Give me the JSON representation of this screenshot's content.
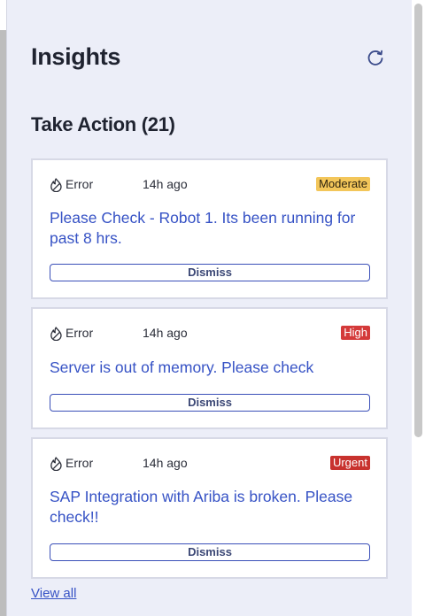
{
  "header": {
    "title": "Insights",
    "refresh_icon": "refresh-icon"
  },
  "section": {
    "title": "Take Action (21)"
  },
  "cards": [
    {
      "type_icon": "error-icon",
      "type_label": "Error",
      "time": "14h ago",
      "severity": "Moderate",
      "severity_color": "#f3c65a",
      "message": "Please Check - Robot 1. Its been running for past 8 hrs.",
      "action": "Dismiss"
    },
    {
      "type_icon": "error-icon",
      "type_label": "Error",
      "time": "14h ago",
      "severity": "High",
      "severity_color": "#d43a3a",
      "message": "Server is out of memory. Please check",
      "action": "Dismiss"
    },
    {
      "type_icon": "error-icon",
      "type_label": "Error",
      "time": "14h ago",
      "severity": "Urgent",
      "severity_color": "#c8322e",
      "message": "SAP Integration with Ariba is broken. Please check!!",
      "action": "Dismiss"
    }
  ],
  "footer": {
    "view_all": "View all"
  },
  "colors": {
    "panel_bg": "#eceef8",
    "link": "#3652c5",
    "dismiss_border": "#3a4fb8"
  }
}
